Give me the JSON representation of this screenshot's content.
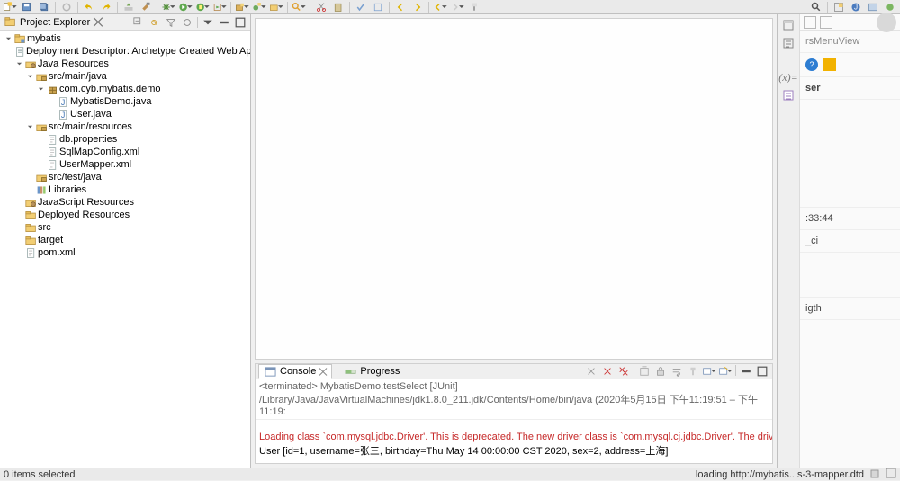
{
  "toolbar": {},
  "projectExplorer": {
    "title": "Project Explorer",
    "root": {
      "label": "mybatis",
      "children": [
        {
          "label": "Deployment Descriptor: Archetype Created Web Application",
          "icon": "doc"
        },
        {
          "label": "Java Resources",
          "icon": "folder-jar",
          "open": true,
          "children": [
            {
              "label": "src/main/java",
              "icon": "pkgfolder",
              "open": true,
              "children": [
                {
                  "label": "com.cyb.mybatis.demo",
                  "icon": "package",
                  "open": true,
                  "children": [
                    {
                      "label": "MybatisDemo.java",
                      "icon": "java"
                    },
                    {
                      "label": "User.java",
                      "icon": "java"
                    }
                  ]
                }
              ]
            },
            {
              "label": "src/main/resources",
              "icon": "pkgfolder",
              "open": true,
              "children": [
                {
                  "label": "db.properties",
                  "icon": "file"
                },
                {
                  "label": "SqlMapConfig.xml",
                  "icon": "file"
                },
                {
                  "label": "UserMapper.xml",
                  "icon": "file"
                }
              ]
            },
            {
              "label": "src/test/java",
              "icon": "pkgfolder"
            },
            {
              "label": "Libraries",
              "icon": "lib"
            }
          ]
        },
        {
          "label": "JavaScript Resources",
          "icon": "folder-jar"
        },
        {
          "label": "Deployed Resources",
          "icon": "folder"
        },
        {
          "label": "src",
          "icon": "folder"
        },
        {
          "label": "target",
          "icon": "folder"
        },
        {
          "label": "pom.xml",
          "icon": "file"
        }
      ]
    }
  },
  "bottom": {
    "tabs": {
      "console": "Console",
      "progress": "Progress"
    },
    "terminated": "<terminated> MybatisDemo.testSelect [JUnit] /Library/Java/JavaVirtualMachines/jdk1.8.0_211.jdk/Contents/Home/bin/java  (2020年5月15日 下午11:19:51 – 下午11:19:",
    "line1": "Loading class `com.mysql.jdbc.Driver'. This is deprecated. The new driver class is `com.mysql.cj.jdbc.Driver'. The driver is",
    "line2": "User [id=1, username=张三, birthday=Thu May 14 00:00:00 CST 2020, sex=2, address=上海]"
  },
  "rightPane": {
    "title": "rsMenuView",
    "row_ser": "ser",
    "row_time": ":33:44",
    "row_ci": "_ci",
    "row_igth": "igth"
  },
  "status": {
    "left": "0 items selected",
    "right": "loading http://mybatis...s-3-mapper.dtd"
  }
}
